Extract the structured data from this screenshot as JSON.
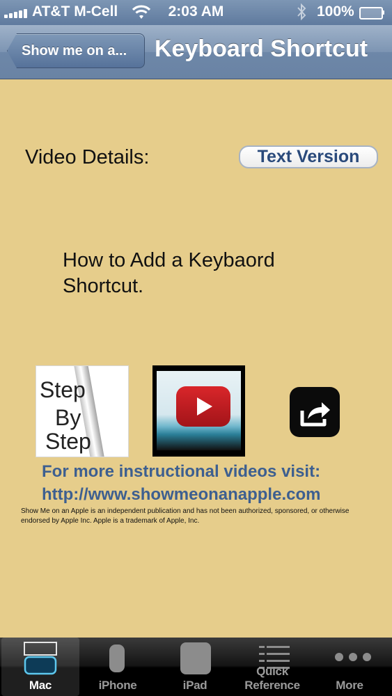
{
  "status_bar": {
    "carrier": "AT&T M-Cell",
    "time": "2:03 AM",
    "battery": "100%"
  },
  "nav": {
    "back_label": "Show me on a...",
    "title": "Keyboard Shortcut"
  },
  "content": {
    "details_label": "Video Details:",
    "text_version_button": "Text Version",
    "video_title": "How to Add a Keybaord Shortcut.",
    "step_by_step_lines": [
      "Step",
      "By",
      "Step"
    ],
    "more_videos_line1": "For more instructional videos visit:",
    "more_videos_line2": "http://www.showmeonanapple.com",
    "disclaimer": "Show Me on an Apple is an independent publication and has not been authorized, sponsored, or otherwise endorsed by Apple Inc. Apple is a trademark of Apple, Inc."
  },
  "tab_bar": {
    "tabs": [
      {
        "label": "Mac",
        "icon": "mac-icon",
        "active": true
      },
      {
        "label": "iPhone",
        "icon": "iphone-icon",
        "active": false
      },
      {
        "label": "iPad",
        "icon": "ipad-icon",
        "active": false
      },
      {
        "label": "Quick Reference",
        "icon": "list-icon",
        "active": false
      },
      {
        "label": "More",
        "icon": "more-icon",
        "active": false
      }
    ]
  },
  "colors": {
    "background": "#e6cd8b",
    "nav_bar": "#7d95b3",
    "link_text": "#3d5f90",
    "button_text": "#2a4a7b"
  }
}
